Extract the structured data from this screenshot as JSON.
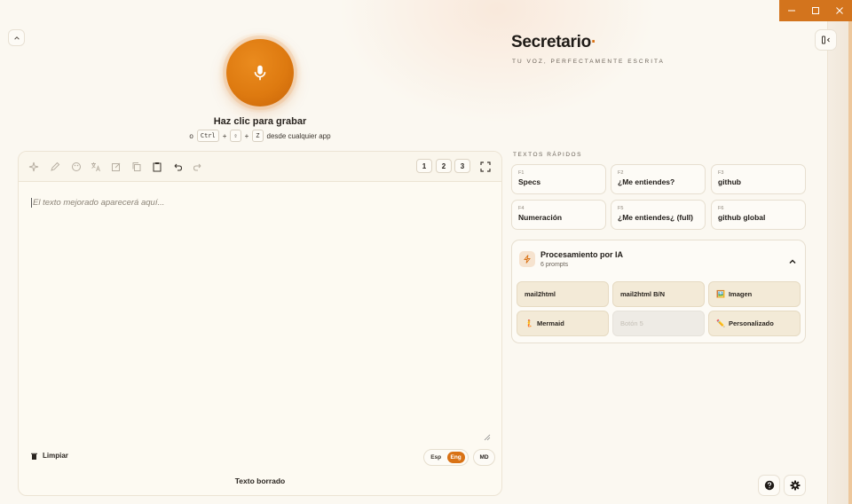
{
  "brand": {
    "name": "Secretario",
    "dot": "·",
    "tagline": "TU VOZ, PERFECTAMENTE ESCRITA"
  },
  "recorder": {
    "label": "Haz clic para grabar",
    "prefix": "o",
    "keys": [
      "Ctrl",
      "⇧",
      "Z"
    ],
    "plus": "+",
    "suffix": "desde cualquier app"
  },
  "editor": {
    "placeholder": "El texto mejorado aparecerá aquí...",
    "slots": [
      "1",
      "2",
      "3"
    ],
    "clear_label": "Limpiar",
    "lang_options": [
      "Esp",
      "Eng"
    ],
    "lang_active": "Eng",
    "md_label": "MD",
    "status": "Texto borrado"
  },
  "quick_texts": {
    "title": "TEXTOS RÁPIDOS",
    "items": [
      {
        "key": "F1",
        "label": "Specs"
      },
      {
        "key": "F2",
        "label": "¿Me entiendes?"
      },
      {
        "key": "F3",
        "label": "github"
      },
      {
        "key": "F4",
        "label": "Numeración"
      },
      {
        "key": "F5",
        "label": "¿Me entiendes¿ (full)"
      },
      {
        "key": "F6",
        "label": "github global"
      }
    ]
  },
  "ai": {
    "title": "Procesamiento por IA",
    "subtitle": "6 prompts",
    "prompts": [
      {
        "icon": "",
        "label": "mail2html"
      },
      {
        "icon": "",
        "label": "mail2html B/N"
      },
      {
        "icon": "🖼️",
        "label": "Imagen"
      },
      {
        "icon": "🧜",
        "label": "Mermaid"
      },
      {
        "icon": "",
        "label": "Botón 5"
      },
      {
        "icon": "✏️",
        "label": "Personalizado"
      }
    ]
  },
  "colors": {
    "accent": "#d97215",
    "background": "#fbf8f1"
  }
}
